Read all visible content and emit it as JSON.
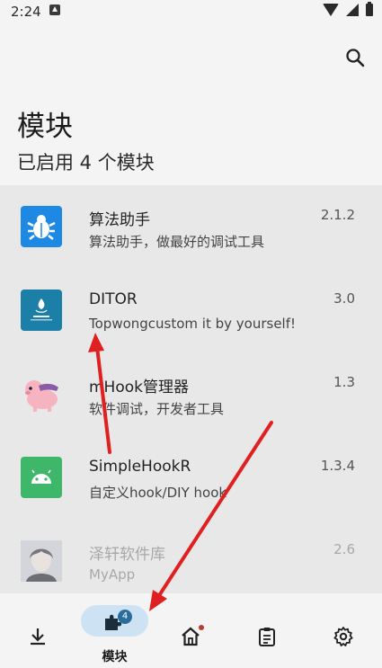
{
  "status": {
    "time": "2:24"
  },
  "header": {
    "title": "模块",
    "subtitle": "已启用 4 个模块"
  },
  "modules": [
    {
      "name": "算法助手",
      "desc": "算法助手，做最好的调试工具",
      "version": "2.1.2",
      "icon": "bug-icon"
    },
    {
      "name": "DITOR",
      "desc": "Topwongcustom it by yourself!",
      "version": "3.0",
      "icon": "ditor-logo-icon"
    },
    {
      "name": "mHook管理器",
      "desc": "软件调试，开发者工具",
      "version": "1.3",
      "icon": "pig-mascot-icon"
    },
    {
      "name": "SimpleHookR",
      "desc": "自定义hook/DIY hook",
      "version": "1.3.4",
      "icon": "android-icon"
    },
    {
      "name": "泽轩软件库",
      "desc": "MyApp",
      "version": "2.6",
      "icon": "anime-avatar-icon"
    }
  ],
  "nav": {
    "modules_label": "模块",
    "modules_badge": "4"
  },
  "colors": {
    "accent": "#2b6d9a",
    "pill": "#cde3f3",
    "arrow": "#e02020"
  }
}
